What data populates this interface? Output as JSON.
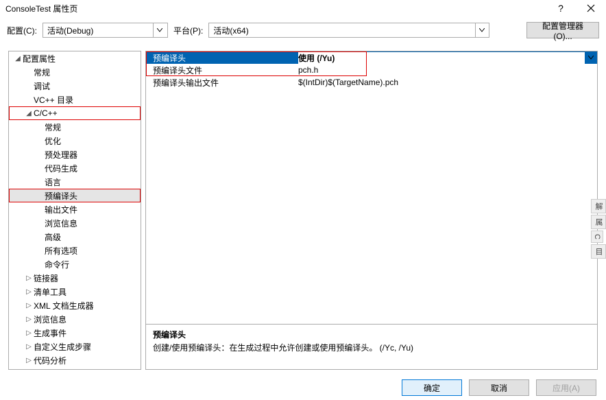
{
  "title": "ConsoleTest 属性页",
  "titlebar": {
    "help": "?",
    "close": "×"
  },
  "toolbar": {
    "config_label": "配置(C):",
    "config_value": "活动(Debug)",
    "platform_label": "平台(P):",
    "platform_value": "活动(x64)",
    "manager_label": "配置管理器(O)..."
  },
  "tree": [
    {
      "label": "配置属性",
      "depth": 0,
      "expander": "◢",
      "sel": false,
      "box": false
    },
    {
      "label": "常规",
      "depth": 1,
      "expander": "",
      "sel": false,
      "box": false
    },
    {
      "label": "调试",
      "depth": 1,
      "expander": "",
      "sel": false,
      "box": false
    },
    {
      "label": "VC++ 目录",
      "depth": 1,
      "expander": "",
      "sel": false,
      "box": false
    },
    {
      "label": "C/C++",
      "depth": 1,
      "expander": "◢",
      "sel": false,
      "box": true
    },
    {
      "label": "常规",
      "depth": 2,
      "expander": "",
      "sel": false,
      "box": false
    },
    {
      "label": "优化",
      "depth": 2,
      "expander": "",
      "sel": false,
      "box": false
    },
    {
      "label": "预处理器",
      "depth": 2,
      "expander": "",
      "sel": false,
      "box": false
    },
    {
      "label": "代码生成",
      "depth": 2,
      "expander": "",
      "sel": false,
      "box": false
    },
    {
      "label": "语言",
      "depth": 2,
      "expander": "",
      "sel": false,
      "box": false
    },
    {
      "label": "预编译头",
      "depth": 2,
      "expander": "",
      "sel": true,
      "box": true
    },
    {
      "label": "输出文件",
      "depth": 2,
      "expander": "",
      "sel": false,
      "box": false
    },
    {
      "label": "浏览信息",
      "depth": 2,
      "expander": "",
      "sel": false,
      "box": false
    },
    {
      "label": "高级",
      "depth": 2,
      "expander": "",
      "sel": false,
      "box": false
    },
    {
      "label": "所有选项",
      "depth": 2,
      "expander": "",
      "sel": false,
      "box": false
    },
    {
      "label": "命令行",
      "depth": 2,
      "expander": "",
      "sel": false,
      "box": false
    },
    {
      "label": "链接器",
      "depth": 1,
      "expander": "▷",
      "sel": false,
      "box": false
    },
    {
      "label": "清单工具",
      "depth": 1,
      "expander": "▷",
      "sel": false,
      "box": false
    },
    {
      "label": "XML 文档生成器",
      "depth": 1,
      "expander": "▷",
      "sel": false,
      "box": false
    },
    {
      "label": "浏览信息",
      "depth": 1,
      "expander": "▷",
      "sel": false,
      "box": false
    },
    {
      "label": "生成事件",
      "depth": 1,
      "expander": "▷",
      "sel": false,
      "box": false
    },
    {
      "label": "自定义生成步骤",
      "depth": 1,
      "expander": "▷",
      "sel": false,
      "box": false
    },
    {
      "label": "代码分析",
      "depth": 1,
      "expander": "▷",
      "sel": false,
      "box": false
    }
  ],
  "props": [
    {
      "name": "预编译头",
      "value": "使用 (/Yu)",
      "selected": true
    },
    {
      "name": "预编译头文件",
      "value": "pch.h",
      "selected": false
    },
    {
      "name": "预编译头输出文件",
      "value": "$(IntDir)$(TargetName).pch",
      "selected": false
    }
  ],
  "desc": {
    "title": "预编译头",
    "body": "创建/使用预编译头：在生成过程中允许创建或使用预编译头。     (/Yc, /Yu)"
  },
  "footer": {
    "ok": "确定",
    "cancel": "取消",
    "apply": "应用(A)"
  },
  "sidetabs": [
    "解",
    "属",
    "C",
    "目"
  ]
}
